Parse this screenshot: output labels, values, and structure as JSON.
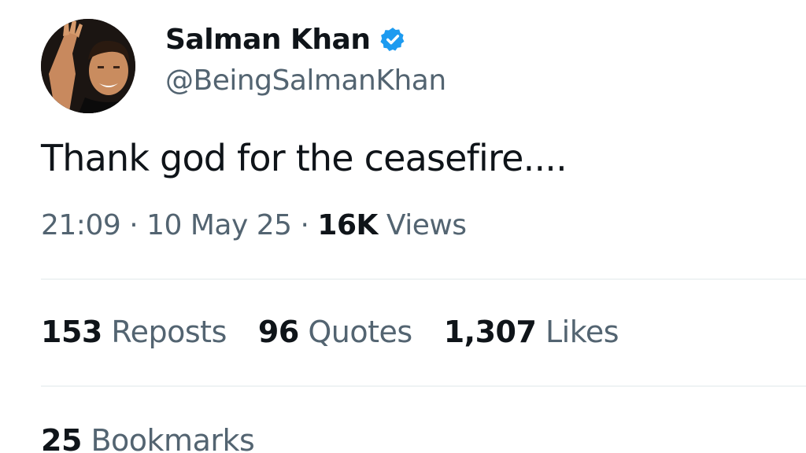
{
  "author": {
    "display_name": "Salman Khan",
    "handle": "@BeingSalmanKhan",
    "verified": true,
    "verified_badge_color": "#1d9bf0"
  },
  "tweet": {
    "text": "Thank god for the ceasefire....",
    "time": "21:09",
    "date": "10 May 25",
    "separator": "·",
    "views_count": "16K",
    "views_label": "Views"
  },
  "stats": {
    "reposts_count": "153",
    "reposts_label": "Reposts",
    "quotes_count": "96",
    "quotes_label": "Quotes",
    "likes_count": "1,307",
    "likes_label": "Likes",
    "bookmarks_count": "25",
    "bookmarks_label": "Bookmarks"
  }
}
